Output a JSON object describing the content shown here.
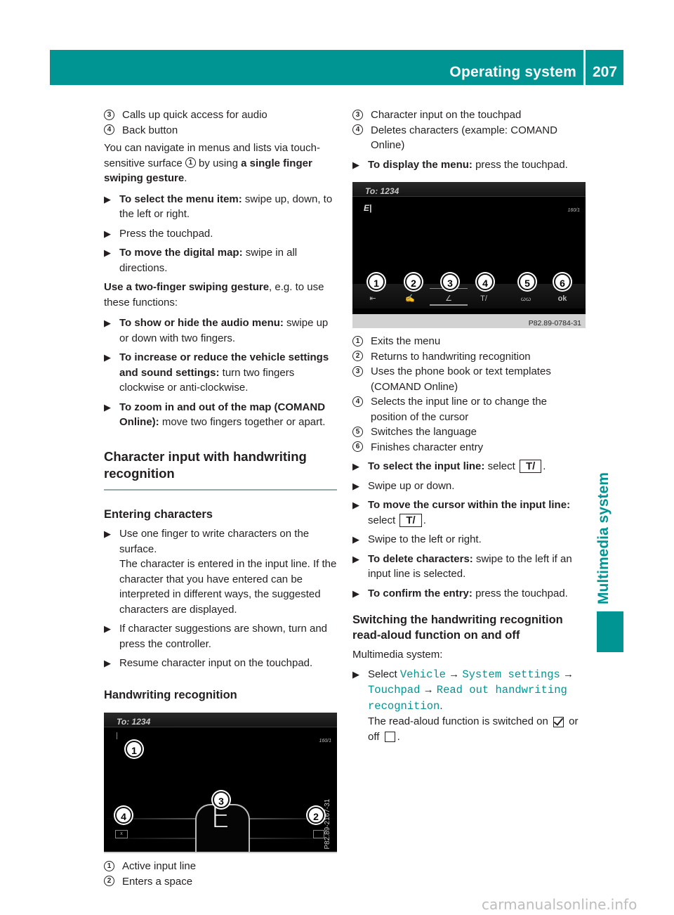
{
  "header": {
    "section_title": "Operating system",
    "page_number": "207"
  },
  "side_tab": {
    "label": "Multimedia system"
  },
  "colors": {
    "accent": "#009593",
    "text": "#231f20",
    "link_mono": "#009593"
  },
  "left": {
    "legend_top": [
      {
        "num": "3",
        "text": "Calls up quick access for audio"
      },
      {
        "num": "4",
        "text": "Back button"
      }
    ],
    "intro": {
      "pre": "You can navigate in menus and lists via touch-sensitive surface ",
      "ref": "1",
      "mid": " by using ",
      "bold": "a single finger swiping gesture",
      "post": "."
    },
    "steps1": [
      {
        "bold": "To select the menu item:",
        "text": " swipe up, down, to the left or right."
      },
      {
        "bold": "",
        "text": "Press the touchpad."
      },
      {
        "bold": "To move the digital map:",
        "text": " swipe in all directions."
      }
    ],
    "two_finger": {
      "bold": "Use a two-finger swiping gesture",
      "text": ", e.g. to use these functions:"
    },
    "steps2": [
      {
        "bold": "To show or hide the audio menu:",
        "text": " swipe up or down with two fingers."
      },
      {
        "bold": "To increase or reduce the vehicle settings and sound settings:",
        "text": " turn two fingers clockwise or anti-clockwise."
      },
      {
        "bold": "To zoom in and out of the map (COMAND Online):",
        "text": " move two fingers together or apart."
      }
    ],
    "heading_main": "Character input with handwriting recognition",
    "heading_entering": "Entering characters",
    "steps3": [
      {
        "text": "Use one finger to write characters on the surface.",
        "note": "The character is entered in the input line. If the character that you have entered can be interpreted in different ways, the suggested characters are displayed."
      },
      {
        "text": "If character suggestions are shown, turn and press the controller.",
        "note": ""
      },
      {
        "text": "Resume character input on the touchpad.",
        "note": ""
      }
    ],
    "heading_hw": "Handwriting recognition",
    "screenshot_hw": {
      "to_label": "To: 1234",
      "counter": "160/1",
      "handwritten_char": "E",
      "back_icon_label": "x",
      "code": "P82.89-2167-31",
      "callouts": [
        "1",
        "2",
        "3",
        "4"
      ]
    },
    "legend_bottom": [
      {
        "num": "1",
        "text": "Active input line"
      },
      {
        "num": "2",
        "text": "Enters a space"
      }
    ]
  },
  "right": {
    "legend_top": [
      {
        "num": "3",
        "text": "Character input on the touchpad"
      },
      {
        "num": "4",
        "text": "Deletes characters (example: COMAND Online)"
      }
    ],
    "display_menu_step": {
      "bold": "To display the menu:",
      "text": " press the touchpad."
    },
    "screenshot_menu": {
      "to_label": "To: 1234",
      "input_char": "E|",
      "counter": "160/1",
      "callouts": [
        "1",
        "2",
        "3",
        "4",
        "5",
        "6"
      ],
      "menu_icons": [
        {
          "name": "exit-icon",
          "glyph": "⇤"
        },
        {
          "name": "handwriting-icon",
          "glyph": "✍"
        },
        {
          "name": "templates-icon",
          "glyph": "∠"
        },
        {
          "name": "text-cursor-icon",
          "glyph": "T/"
        },
        {
          "name": "language-icon",
          "glyph": "ꞷꞷ"
        },
        {
          "name": "ok-icon",
          "glyph": "ok"
        }
      ],
      "code": "P82.89-0784-31"
    },
    "legend_menu": [
      {
        "num": "1",
        "text": "Exits the menu"
      },
      {
        "num": "2",
        "text": "Returns to handwriting recognition"
      },
      {
        "num": "3",
        "text": "Uses the phone book or text templates (COMAND Online)"
      },
      {
        "num": "4",
        "text": "Selects the input line or to change the position of the cursor"
      },
      {
        "num": "5",
        "text": "Switches the language"
      },
      {
        "num": "6",
        "text": "Finishes character entry"
      }
    ],
    "steps": [
      {
        "bold": "To select the input line:",
        "text": " select ",
        "key": "T/",
        "post": "."
      },
      {
        "bold": "",
        "text": "Swipe up or down.",
        "key": "",
        "post": ""
      },
      {
        "bold": "To move the cursor within the input line:",
        "text": " select ",
        "key": "T/",
        "post": "."
      },
      {
        "bold": "",
        "text": "Swipe to the left or right.",
        "key": "",
        "post": ""
      },
      {
        "bold": "To delete characters:",
        "text": " swipe to the left if an input line is selected.",
        "key": "",
        "post": ""
      },
      {
        "bold": "To confirm the entry:",
        "text": " press the touchpad.",
        "key": "",
        "post": ""
      }
    ],
    "heading_switch": "Switching the handwriting recognition read-aloud function on and off",
    "multimedia_label": "Multimedia system:",
    "select_step": {
      "select": "Select ",
      "path": [
        "Vehicle",
        "System settings",
        "Touchpad",
        "Read out handwriting recognition"
      ],
      "arrow": "→",
      "end": ".",
      "note_pre": "The read-aloud function is switched on ",
      "note_mid": " or off ",
      "note_end": "."
    }
  },
  "watermark": "carmanualsonline.info"
}
